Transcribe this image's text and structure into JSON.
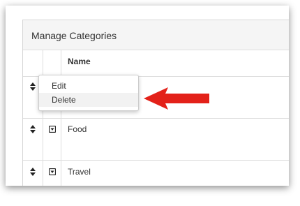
{
  "panel": {
    "title": "Manage Categories"
  },
  "table": {
    "columns": [
      "Name"
    ],
    "rows": [
      {
        "label": ""
      },
      {
        "label": "Food"
      },
      {
        "label": "Travel"
      }
    ]
  },
  "context_menu": {
    "items": [
      {
        "label": "Edit"
      },
      {
        "label": "Delete"
      }
    ],
    "highlighted_item": "Delete"
  },
  "annotation": {
    "arrow_color": "#e32119"
  },
  "icons": {
    "drag": "drag-handle-icon",
    "toggle": "dropdown-toggle-icon"
  }
}
